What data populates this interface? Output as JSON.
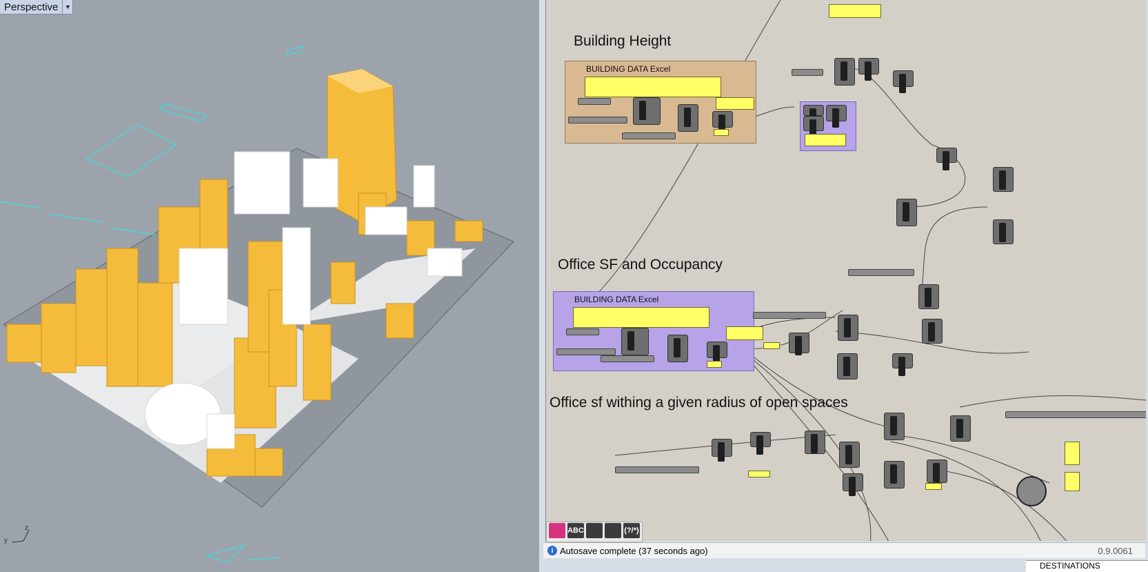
{
  "viewport": {
    "label": "Perspective",
    "axis_z": "z",
    "axis_y": "y"
  },
  "gh": {
    "sections": [
      "Building Height",
      "Office SF and Occupancy",
      "Office sf withing a given radius of open spaces"
    ],
    "groups": [
      "BUILDING DATA Excel",
      "BUILDING DATA Excel"
    ],
    "toolbar": [
      "",
      "ABC",
      "",
      "",
      "(?/*)"
    ],
    "status_text": "Autosave complete (37 seconds ago)",
    "version": "0.9.0061"
  },
  "side_panel": {
    "item": "DESTINATIONS"
  },
  "colors": {
    "building": "#f5bc3c",
    "white_building": "#ffffff",
    "canvas_bg": "#d4d0c8",
    "group_tan": "#d9b992",
    "group_purple": "#b6a3e8",
    "panel_yellow": "#ffff66"
  }
}
